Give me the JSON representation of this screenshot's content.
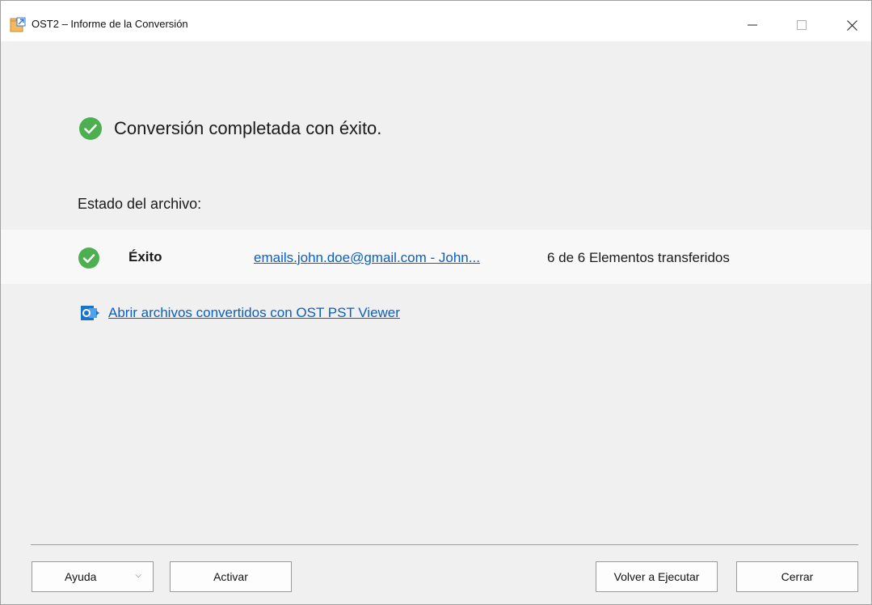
{
  "window": {
    "title": "OST2 – Informe de la Conversión",
    "app_icon": "folder-export-icon",
    "controls": {
      "minimize": "minimize-icon",
      "maximize": "maximize-icon",
      "close": "close-icon"
    }
  },
  "main": {
    "headline": "Conversión completada con éxito.",
    "status_label": "Estado del archivo:",
    "result": {
      "status": "Éxito",
      "file_link": "emails.john.doe@gmail.com - John...",
      "count_text": "6 de 6 Elementos transferidos"
    },
    "viewer_link": "Abrir archivos convertidos con OST PST Viewer"
  },
  "footer": {
    "help_label": "Ayuda",
    "activate_label": "Activar",
    "rerun_label": "Volver a Ejecutar",
    "close_label": "Cerrar"
  },
  "colors": {
    "success": "#4caf50",
    "link": "#0a5fc4",
    "accent_blue": "#1a73c9"
  }
}
